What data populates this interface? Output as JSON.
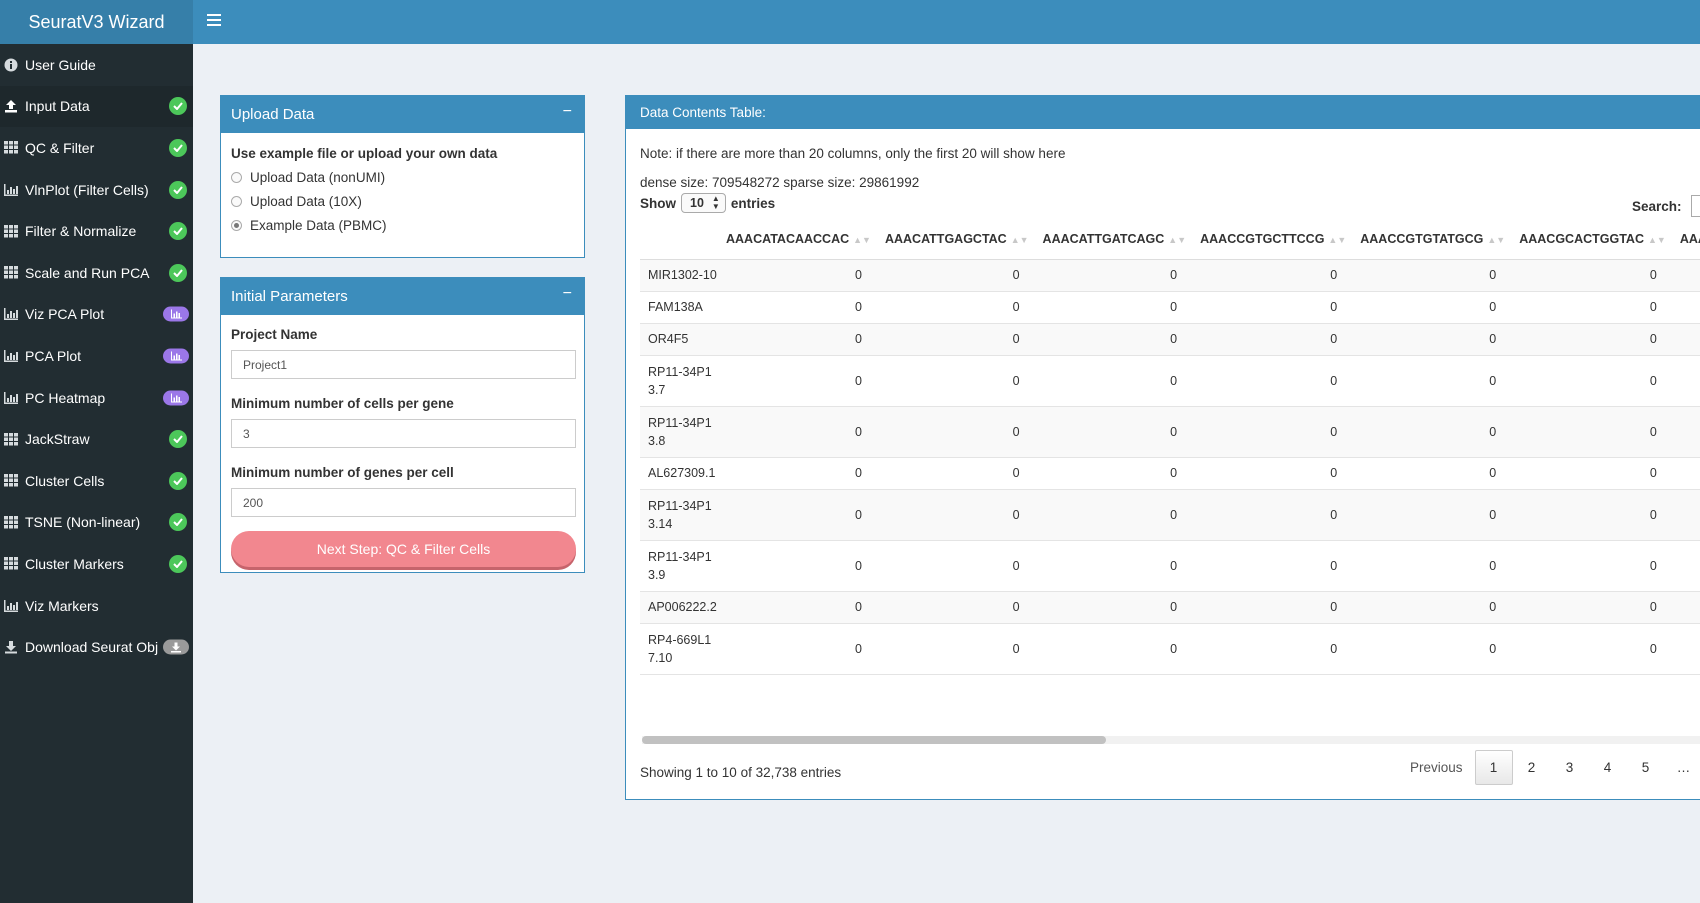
{
  "app": {
    "title": "SeuratV3 Wizard"
  },
  "sidebar": {
    "items": [
      {
        "label": "User Guide",
        "icon": "info-icon",
        "badge": "none"
      },
      {
        "label": "Input Data",
        "icon": "upload-icon",
        "badge": "check",
        "active": true
      },
      {
        "label": "QC & Filter",
        "icon": "grid-icon",
        "badge": "check"
      },
      {
        "label": "VlnPlot (Filter Cells)",
        "icon": "bar-chart-icon",
        "badge": "check"
      },
      {
        "label": "Filter & Normalize",
        "icon": "grid-icon",
        "badge": "check"
      },
      {
        "label": "Scale and Run PCA",
        "icon": "grid-icon",
        "badge": "check"
      },
      {
        "label": "Viz PCA Plot",
        "icon": "bar-chart-icon",
        "badge": "chart"
      },
      {
        "label": "PCA Plot",
        "icon": "bar-chart-icon",
        "badge": "chart"
      },
      {
        "label": "PC Heatmap",
        "icon": "bar-chart-icon",
        "badge": "chart"
      },
      {
        "label": "JackStraw",
        "icon": "grid-icon",
        "badge": "check"
      },
      {
        "label": "Cluster Cells",
        "icon": "grid-icon",
        "badge": "check"
      },
      {
        "label": "TSNE (Non-linear)",
        "icon": "grid-icon",
        "badge": "check"
      },
      {
        "label": "Cluster Markers",
        "icon": "grid-icon",
        "badge": "check"
      },
      {
        "label": "Viz Markers",
        "icon": "bar-chart-icon",
        "badge": "none"
      },
      {
        "label": "Download Seurat Obj",
        "icon": "download-icon",
        "badge": "download"
      }
    ]
  },
  "upload_box": {
    "title": "Upload Data",
    "collapse": "−",
    "prompt": "Use example file or upload your own data",
    "options": [
      "Upload Data (nonUMI)",
      "Upload Data (10X)",
      "Example Data (PBMC)"
    ],
    "selected_index": 2
  },
  "params_box": {
    "title": "Initial Parameters",
    "collapse": "−",
    "project_label": "Project Name",
    "project_value": "Project1",
    "min_cells_label": "Minimum number of cells per gene",
    "min_cells_value": "3",
    "min_genes_label": "Minimum number of genes per cell",
    "min_genes_value": "200",
    "next_button": "Next Step: QC & Filter Cells"
  },
  "table_box": {
    "title": "Data Contents Table:",
    "note": "Note: if there are more than 20 columns, only the first 20 will show here",
    "sizes": "dense size: 709548272 sparse size: 29861992",
    "show_label": "Show",
    "show_value": "10",
    "entries_label": "entries",
    "search_label": "Search:",
    "columns": [
      "AAACATACAACCAC",
      "AAACATTGAGCTAC",
      "AAACATTGATCAGC",
      "AAACCGTGCTTCCG",
      "AAACCGTGTATGCG",
      "AAACGCACTGGTAC",
      "AAACGCTGA"
    ],
    "rows": [
      {
        "gene": "MIR1302-10",
        "values": [
          "0",
          "0",
          "0",
          "0",
          "0",
          "0"
        ]
      },
      {
        "gene": "FAM138A",
        "values": [
          "0",
          "0",
          "0",
          "0",
          "0",
          "0"
        ]
      },
      {
        "gene": "OR4F5",
        "values": [
          "0",
          "0",
          "0",
          "0",
          "0",
          "0"
        ]
      },
      {
        "gene": "RP11-34P13.7",
        "values": [
          "0",
          "0",
          "0",
          "0",
          "0",
          "0"
        ]
      },
      {
        "gene": "RP11-34P13.8",
        "values": [
          "0",
          "0",
          "0",
          "0",
          "0",
          "0"
        ]
      },
      {
        "gene": "AL627309.1",
        "values": [
          "0",
          "0",
          "0",
          "0",
          "0",
          "0"
        ]
      },
      {
        "gene": "RP11-34P13.14",
        "values": [
          "0",
          "0",
          "0",
          "0",
          "0",
          "0"
        ]
      },
      {
        "gene": "RP11-34P13.9",
        "values": [
          "0",
          "0",
          "0",
          "0",
          "0",
          "0"
        ]
      },
      {
        "gene": "AP006222.2",
        "values": [
          "0",
          "0",
          "0",
          "0",
          "0",
          "0"
        ]
      },
      {
        "gene": "RP4-669L17.10",
        "values": [
          "0",
          "0",
          "0",
          "0",
          "0",
          "0"
        ]
      }
    ],
    "info": "Showing 1 to 10 of 32,738 entries",
    "pagination": {
      "previous": "Previous",
      "pages": [
        "1",
        "2",
        "3",
        "4",
        "5",
        "…"
      ],
      "current": "1"
    }
  },
  "colors": {
    "header": "#3c8dbc",
    "logo": "#367fa9",
    "sidebar": "#222d32",
    "check_badge": "#4cc75a",
    "chart_badge": "#9b77e8",
    "next_button": "#f2878f"
  }
}
